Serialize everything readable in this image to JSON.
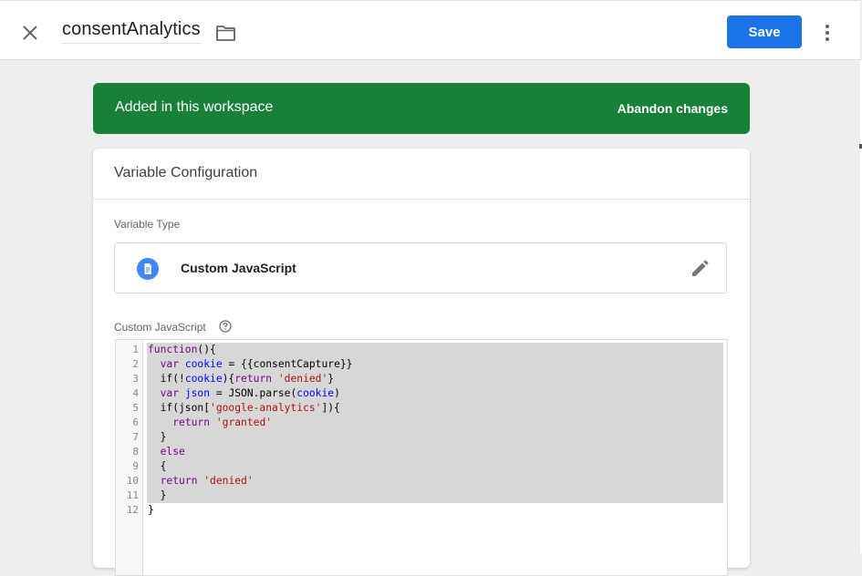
{
  "header": {
    "title": "consentAnalytics",
    "save_label": "Save",
    "close_icon": "close-icon",
    "folder_icon": "folder-icon",
    "more_icon": "more-vert-icon"
  },
  "banner": {
    "text": "Added in this workspace",
    "action": "Abandon changes",
    "color": "#188038"
  },
  "card": {
    "title": "Variable Configuration",
    "variable_type_label": "Variable Type",
    "variable_type": "Custom JavaScript",
    "code_label": "Custom JavaScript"
  },
  "editor": {
    "line_numbers": [
      "1",
      "2",
      "3",
      "4",
      "5",
      "6",
      "7",
      "8",
      "9",
      "10",
      "11",
      "12"
    ],
    "lines": [
      [
        {
          "t": "function",
          "c": "kw"
        },
        {
          "t": "(){",
          "c": ""
        }
      ],
      [
        {
          "t": "  ",
          "c": ""
        },
        {
          "t": "var",
          "c": "kw"
        },
        {
          "t": " ",
          "c": ""
        },
        {
          "t": "cookie",
          "c": "vn"
        },
        {
          "t": " = {{consentCapture}}",
          "c": ""
        }
      ],
      [
        {
          "t": "  if(!",
          "c": ""
        },
        {
          "t": "cookie",
          "c": "vn"
        },
        {
          "t": "){",
          "c": ""
        },
        {
          "t": "return",
          "c": "kw"
        },
        {
          "t": " ",
          "c": ""
        },
        {
          "t": "'denied'",
          "c": "st"
        },
        {
          "t": "}",
          "c": ""
        }
      ],
      [
        {
          "t": "  ",
          "c": ""
        },
        {
          "t": "var",
          "c": "kw"
        },
        {
          "t": " ",
          "c": ""
        },
        {
          "t": "json",
          "c": "vn"
        },
        {
          "t": " = JSON.parse(",
          "c": ""
        },
        {
          "t": "cookie",
          "c": "vn"
        },
        {
          "t": ")",
          "c": ""
        }
      ],
      [
        {
          "t": "  if(json[",
          "c": ""
        },
        {
          "t": "'google-analytics'",
          "c": "st"
        },
        {
          "t": "]){",
          "c": ""
        }
      ],
      [
        {
          "t": "    ",
          "c": ""
        },
        {
          "t": "return",
          "c": "kw"
        },
        {
          "t": " ",
          "c": ""
        },
        {
          "t": "'granted'",
          "c": "st"
        }
      ],
      [
        {
          "t": "  }",
          "c": ""
        }
      ],
      [
        {
          "t": "  ",
          "c": ""
        },
        {
          "t": "else",
          "c": "kw"
        }
      ],
      [
        {
          "t": "  {",
          "c": ""
        }
      ],
      [
        {
          "t": "  ",
          "c": ""
        },
        {
          "t": "return",
          "c": "kw"
        },
        {
          "t": " ",
          "c": ""
        },
        {
          "t": "'denied'",
          "c": "st"
        }
      ],
      [
        {
          "t": "  }",
          "c": ""
        }
      ],
      [
        {
          "t": "}",
          "c": ""
        }
      ]
    ]
  }
}
